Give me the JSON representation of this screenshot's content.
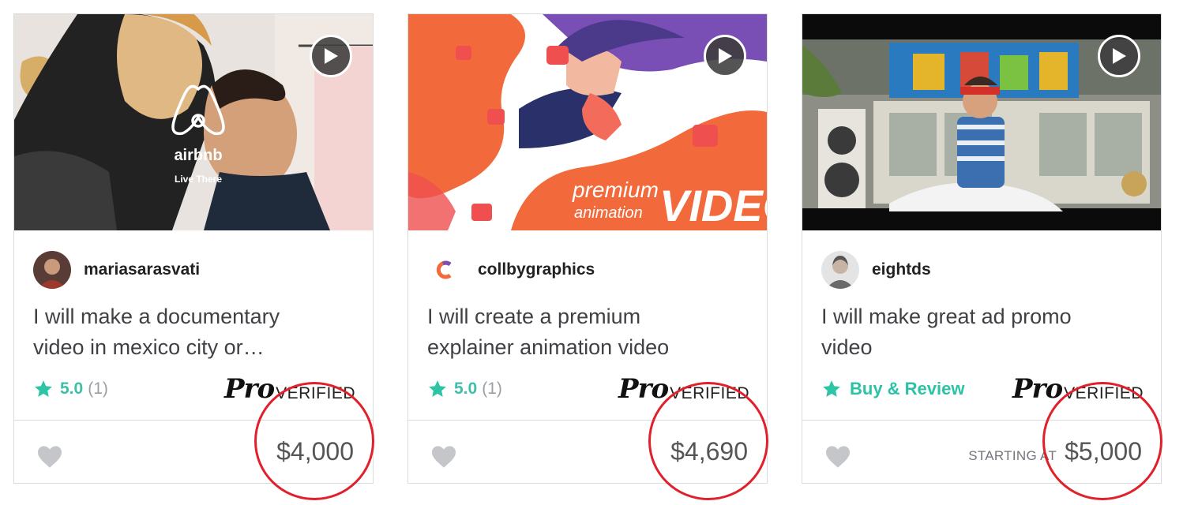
{
  "cards": [
    {
      "seller": "mariasarasvati",
      "title_line1": "I will make a documentary",
      "title_line2": "video in mexico city or…",
      "rating_score": "5.0",
      "rating_count": "(1)",
      "pro_word": "Pro",
      "verified_word": "VERIFIED",
      "price": "$4,000",
      "thumb_brand": "airbnb",
      "thumb_tagline": "Live There"
    },
    {
      "seller": "collbygraphics",
      "title_line1": "I will create a premium",
      "title_line2": "explainer animation video",
      "rating_score": "5.0",
      "rating_count": "(1)",
      "pro_word": "Pro",
      "verified_word": "VERIFIED",
      "price": "$4,690",
      "thumb_text_premium": "premium",
      "thumb_text_animation": "animation",
      "thumb_text_video": "VIDEO"
    },
    {
      "seller": "eightds",
      "title_line1": "I will make great ad promo",
      "title_line2": "video",
      "cta": "Buy & Review",
      "pro_word": "Pro",
      "verified_word": "VERIFIED",
      "starting_label": "STARTING AT",
      "price": "$5,000"
    }
  ],
  "colors": {
    "rating_star": "#2ec4a6",
    "highlight_circle": "#e0212b",
    "border": "#dadbdd"
  },
  "icons": [
    "play-icon",
    "star-icon",
    "heart-icon"
  ]
}
